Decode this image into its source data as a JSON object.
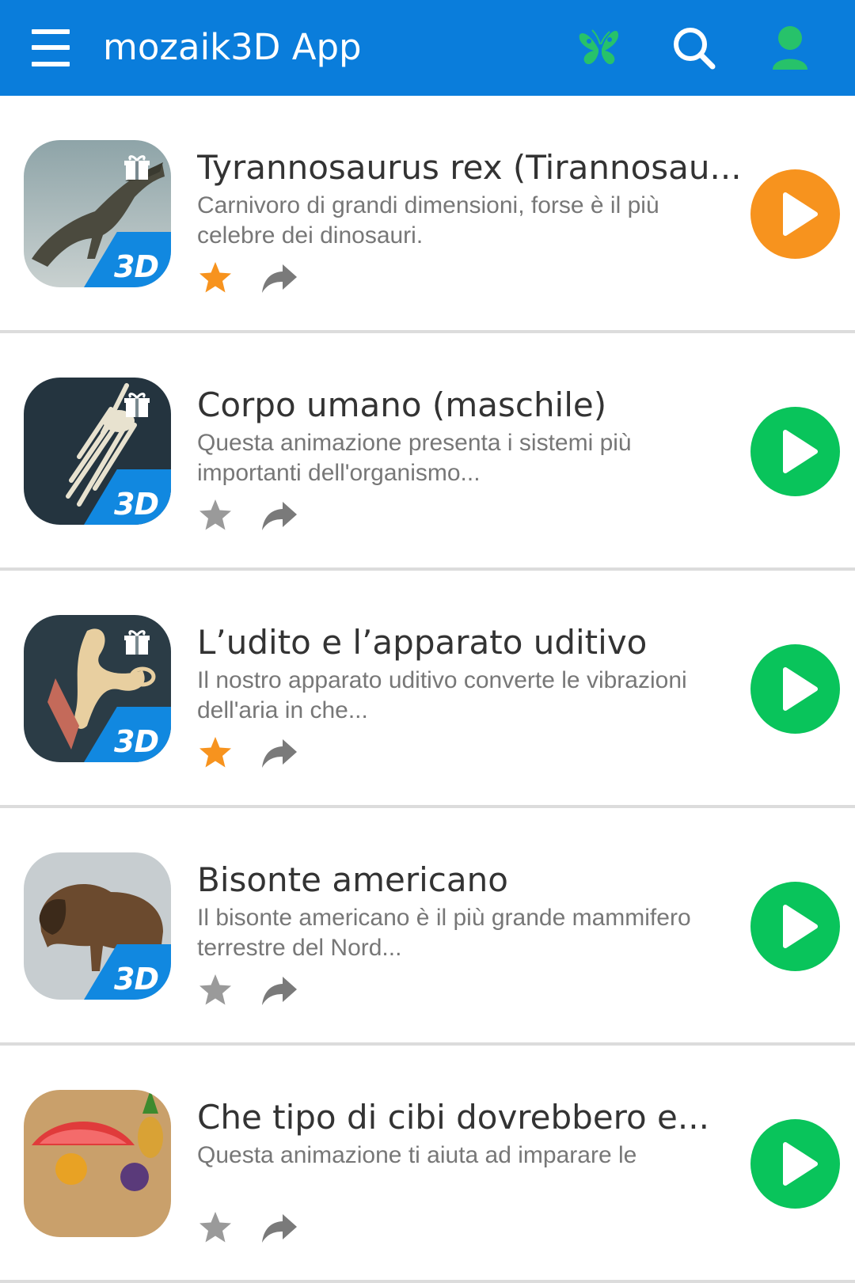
{
  "header": {
    "title": "mozaik3D App",
    "menu_icon": "hamburger-menu-icon",
    "butterfly_icon": "butterfly-icon",
    "search_icon": "search-icon",
    "user_icon": "user-icon",
    "bar_color": "#0a7ddb",
    "butterfly_color": "#27c26a",
    "user_color": "#27c26a"
  },
  "items": [
    {
      "title": "Tyrannosaurus rex (Tirannosau...",
      "description": "Carnivoro di grandi dimensioni, forse è il più celebre dei dinosauri.",
      "badge": "3D",
      "gift": true,
      "favorite": true,
      "play_color": "#f7931e",
      "thumb_subject": "tyrannosaurus"
    },
    {
      "title": "Corpo umano (maschile)",
      "description": "Questa animazione presenta i sistemi più importanti dell'organismo...",
      "badge": "3D",
      "gift": true,
      "favorite": false,
      "play_color": "#09c45b",
      "thumb_subject": "hand-skeleton"
    },
    {
      "title": "L’udito e l’apparato uditivo",
      "description": "Il nostro apparato uditivo converte le vibrazioni dell'aria in che...",
      "badge": "3D",
      "gift": true,
      "favorite": true,
      "play_color": "#09c45b",
      "thumb_subject": "ear-bones"
    },
    {
      "title": "Bisonte americano",
      "description": "Il bisonte americano è il più grande mammifero terrestre del Nord...",
      "badge": "3D",
      "gift": false,
      "favorite": false,
      "play_color": "#09c45b",
      "thumb_subject": "bison"
    },
    {
      "title": "Che tipo di cibi dovrebbero e...",
      "description": "Questa animazione ti aiuta ad imparare le",
      "badge": "",
      "gift": false,
      "favorite": false,
      "play_color": "#09c45b",
      "thumb_subject": "fruit"
    }
  ],
  "colors": {
    "star_active": "#f7931e",
    "star_inactive": "#9a9a9a",
    "share": "#7a7a7a",
    "badge": "#1188e0"
  }
}
